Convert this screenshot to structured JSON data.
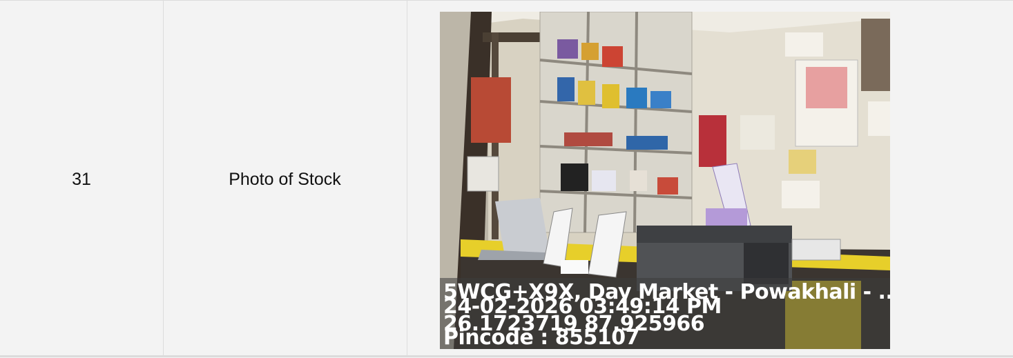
{
  "row": {
    "number": "31",
    "label": "Photo of Stock"
  },
  "photo": {
    "description_icon": "shop-interior-photo",
    "geotag": {
      "address": "5WCG+X9X, Day Market - Powakhali - ...",
      "datetime": "24-02-2026 03:49:14 PM",
      "coordinates": "26.1723719 87.925966",
      "pincode": "Pincode : 855107"
    }
  }
}
